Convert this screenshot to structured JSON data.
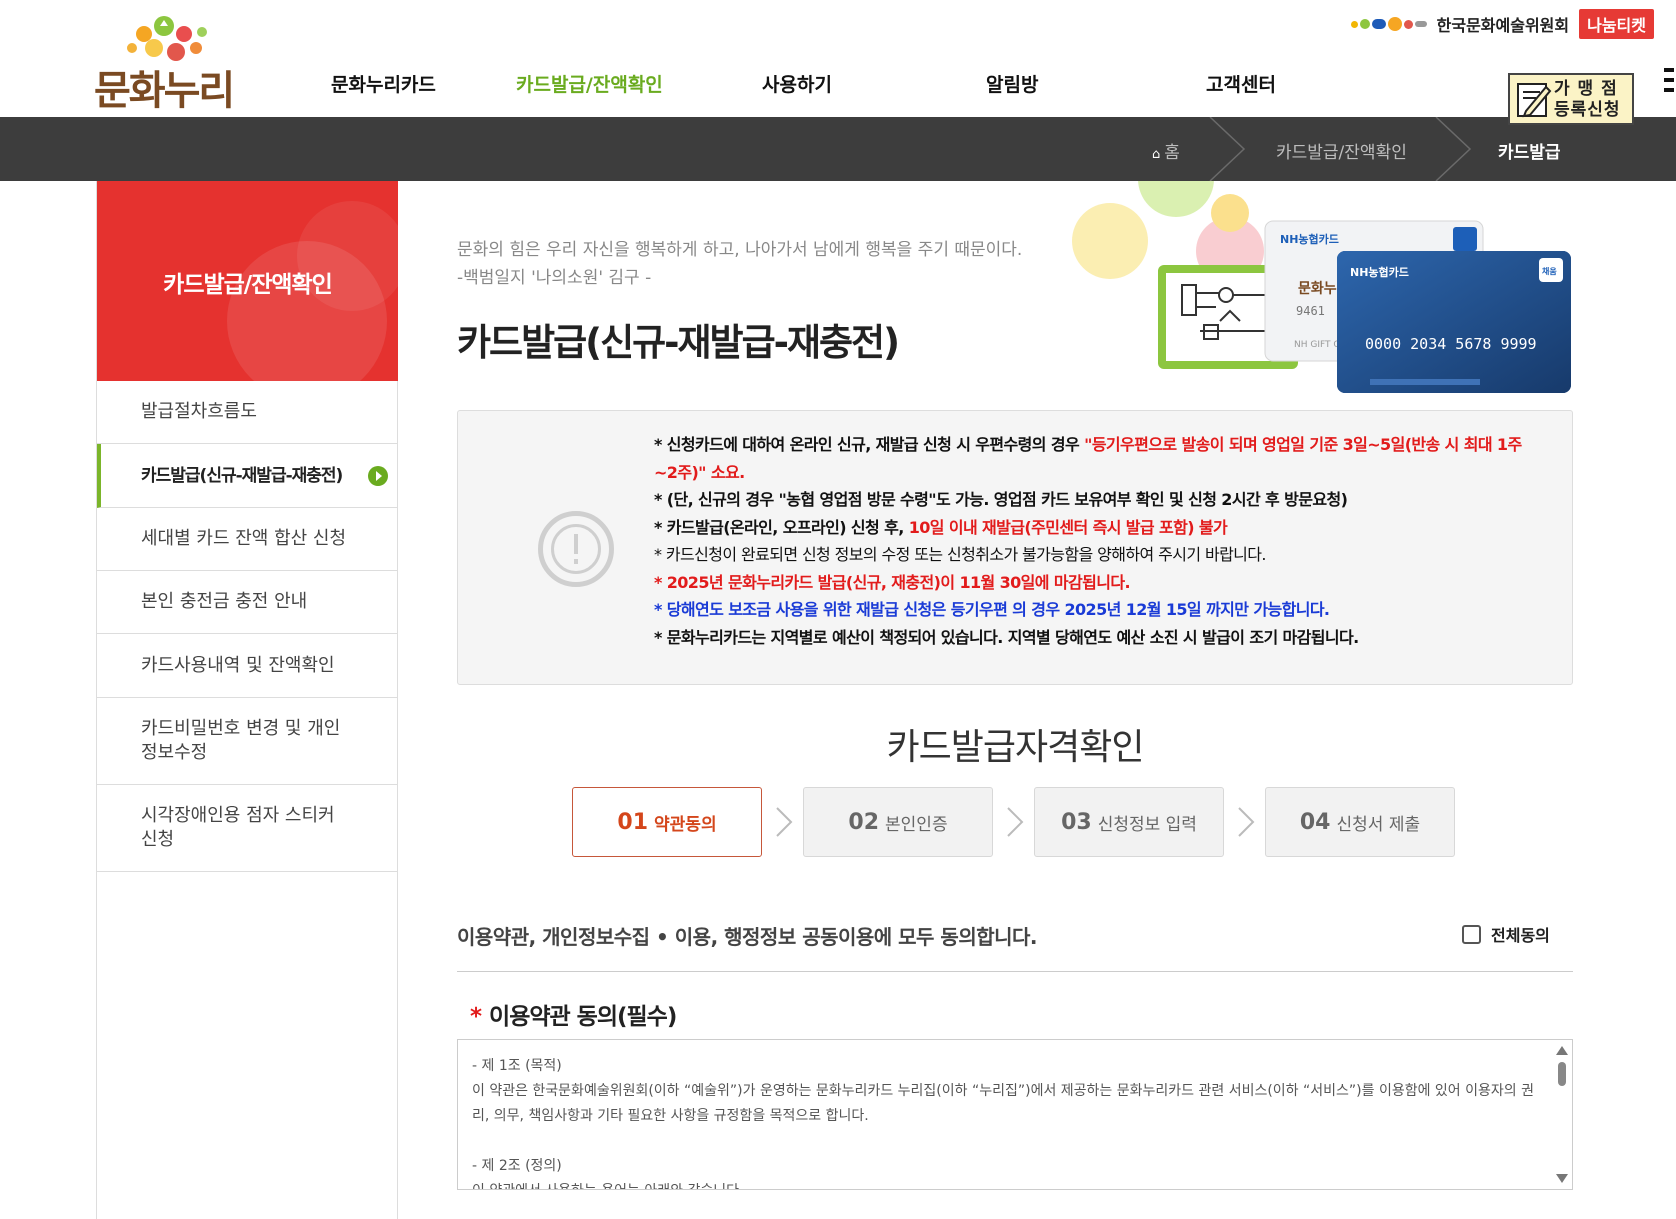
{
  "header": {
    "logo_text": "문화누리",
    "gnb": [
      {
        "label": "문화누리카드",
        "active": false
      },
      {
        "label": "카드발급/잔액확인",
        "active": true
      },
      {
        "label": "사용하기",
        "active": false
      },
      {
        "label": "알림방",
        "active": false
      },
      {
        "label": "고객센터",
        "active": false
      }
    ],
    "arko_label": "한국문화예술위원회",
    "nanum_ticket_label": "나눔티켓",
    "store_register_label": "가 맹 점\n등록신청"
  },
  "breadcrumb": {
    "home": "홈",
    "items": [
      "카드발급/잔액확인",
      "카드발급"
    ]
  },
  "sidebar": {
    "title": "카드발급/잔액확인",
    "items": [
      {
        "label": "발급절차흐름도",
        "active": false
      },
      {
        "label": "카드발급(신규-재발급-재충전)",
        "active": true
      },
      {
        "label": "세대별 카드 잔액 합산 신청",
        "active": false
      },
      {
        "label": "본인 충전금 충전 안내",
        "active": false
      },
      {
        "label": "카드사용내역 및 잔액확인",
        "active": false
      },
      {
        "label": "카드비밀번호 변경 및 개인 정보수정",
        "active": false
      },
      {
        "label": "시각장애인용 점자 스티커 신청",
        "active": false
      }
    ]
  },
  "main": {
    "quote_line1": "문화의 힘은 우리 자신을 행복하게 하고, 나아가서 남에게 행복을 주기 때문이다.",
    "quote_line2": "-백범일지 '나의소원' 김구 -",
    "page_title": "카드발급(신규-재발급-재충전)",
    "hero_card": {
      "brand": "NH농협카드",
      "badge": "채움",
      "number": "0000 2034 5678 9999",
      "back_card_number": "9461",
      "back_card_label": "NH GIFT CA",
      "card_logo": "문화누리"
    },
    "notice": {
      "line1a": "* 신청카드에 대하여 온라인 신규, 재발급 신청 시 우편수령의 경우 ",
      "line1b": "\"등기우편으로 발송이 되며 영업일 기준 3일~5일(반송 시 최대 1주~2주)\" 소요.",
      "line2": "* (단, 신규의 경우 \"농협 영업점 방문 수령\"도 가능. 영업점 카드 보유여부 확인 및 신청 2시간 후 방문요청)",
      "line3a": "* 카드발급(온라인, 오프라인) 신청 후, ",
      "line3b": "10일 이내 재발급(주민센터 즉시 발급 포함) 불가",
      "line4": "* 카드신청이 완료되면 신청 정보의 수정 또는 신청취소가 불가능함을 양해하여 주시기 바랍니다.",
      "line5": "* 2025년 문화누리카드 발급(신규, 재충전)이 11월 30일에 마감됩니다.",
      "line6": "* 당해연도 보조금 사용을 위한 재발급 신청은 등기우편 의 경우 2025년 12월 15일 까지만 가능합니다.",
      "line7": "* 문화누리카드는 지역별로 예산이 책정되어 있습니다. 지역별 당해연도 예산 소진 시 발급이 조기 마감됩니다."
    },
    "eligibility_title": "카드발급자격확인",
    "steps": [
      {
        "num": "01",
        "label": "약관동의",
        "active": true
      },
      {
        "num": "02",
        "label": "본인인증",
        "active": false
      },
      {
        "num": "03",
        "label": "신청정보 입력",
        "active": false
      },
      {
        "num": "04",
        "label": "신청서 제출",
        "active": false
      }
    ],
    "agree_all_text": "이용약관, 개인정보수집 • 이용, 행정정보 공동이용에 모두 동의합니다.",
    "agree_all_label": "전체동의",
    "agree_all_checked": false,
    "terms": {
      "required_mark": "*",
      "title": "이용약관 동의(필수)",
      "article1_title": "- 제 1조 (목적)",
      "article1_body": "이 약관은 한국문화예술위원회(이하 “예술위”)가 운영하는 문화누리카드 누리집(이하 “누리집”)에서 제공하는 문화누리카드 관련 서비스(이하 “서비스”)를 이용함에 있어 이용자의 권리, 의무, 책임사항과 기타 필요한 사항을 규정함을 목적으로 합니다.",
      "article2_title": "- 제 2조 (정의)",
      "article2_body": "이 약관에서 사용하는 용어는 아래와 같습니다."
    }
  },
  "colors": {
    "accent_green": "#6aab1f",
    "sidebar_red": "#e5322f",
    "bar_dark": "#3d3d3d",
    "notice_red": "#e21b1b",
    "notice_blue": "#1a3bd6",
    "step_active": "#d4461b"
  }
}
